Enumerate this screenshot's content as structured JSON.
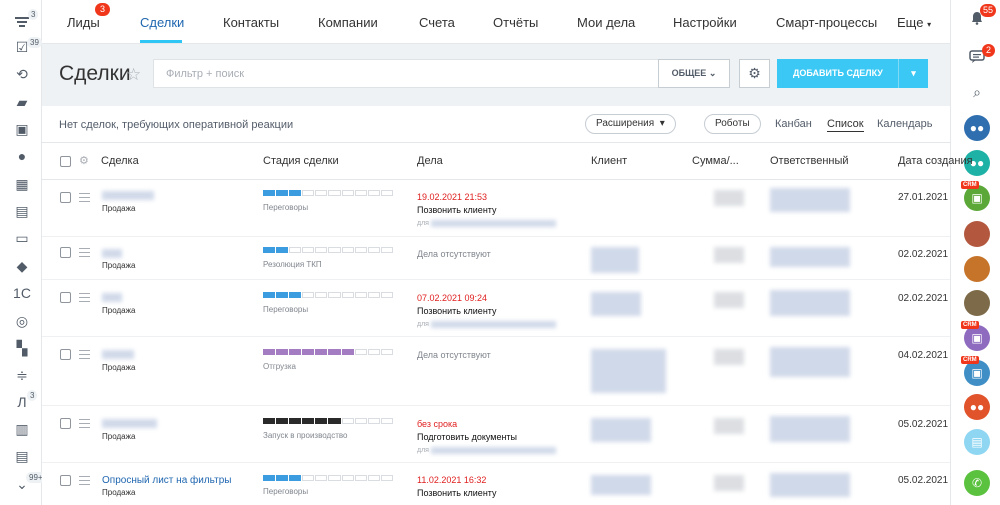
{
  "left_rail": {
    "badges": [
      "3",
      "39",
      "3",
      "99+"
    ],
    "icons": [
      "menu-icon",
      "tasks-icon",
      "sync-icon",
      "chat-icon",
      "contact-card-icon",
      "group-icon",
      "calendar-icon",
      "document-icon",
      "drive-icon",
      "box-icon",
      "crm-icon",
      "target-icon",
      "apps-icon",
      "sliders-icon",
      "l-letter-icon",
      "book-icon",
      "file-icon",
      "more-icon"
    ]
  },
  "topnav": {
    "items": [
      "Лиды",
      "Сделки",
      "Контакты",
      "Компании",
      "Счета",
      "Отчёты",
      "Мои дела",
      "Настройки",
      "Смарт-процессы",
      "Еще"
    ],
    "leads_badge": "3",
    "more_arrow": "▾"
  },
  "right_rail": {
    "bell_badge": "55",
    "chat_badge": "2",
    "crm_tag": "CRM"
  },
  "toolbar": {
    "title": "Сделки",
    "search_placeholder": "Фильтр + поиск",
    "general_label": "ОБЩЕЕ",
    "add_label": "ДОБАВИТЬ СДЕЛКУ"
  },
  "subbar": {
    "text": "Нет сделок, требующих оперативной реакции",
    "extensions_label": "Расширения",
    "robots_label": "Роботы",
    "views": [
      "Канбан",
      "Список",
      "Календарь"
    ]
  },
  "columns": [
    "Сделка",
    "Стадия сделки",
    "Дела",
    "Клиент",
    "Сумма/...",
    "Ответственный",
    "Дата создания"
  ],
  "colors": {
    "accent": "#3bc8f5",
    "link": "#2067b0",
    "stage_blue": "#3b9de0",
    "stage_purple": "#a47cc1",
    "stage_black": "#2a2a2a",
    "overdue": "#e02020"
  },
  "rows": [
    {
      "name": "",
      "type": "Продажа",
      "stage": "Переговоры",
      "stage_fill": 0.3,
      "stage_color": "#3b9de0",
      "act_date": "19.02.2021 21:53",
      "act_text": "Позвонить клиенту",
      "act_for": "для",
      "act_none": "",
      "date": "27.01.2021"
    },
    {
      "name": "",
      "type": "Продажа",
      "stage": "Резолюция ТКП",
      "stage_fill": 0.2,
      "stage_color": "#3b9de0",
      "act_date": "",
      "act_text": "",
      "act_for": "",
      "act_none": "Дела отсутствуют",
      "date": "02.02.2021"
    },
    {
      "name": "",
      "type": "Продажа",
      "stage": "Переговоры",
      "stage_fill": 0.3,
      "stage_color": "#3b9de0",
      "act_date": "07.02.2021 09:24",
      "act_text": "Позвонить клиенту",
      "act_for": "для",
      "act_none": "",
      "date": "02.02.2021"
    },
    {
      "name": "",
      "type": "Продажа",
      "stage": "Отгрузка",
      "stage_fill": 0.7,
      "stage_color": "#a47cc1",
      "act_date": "",
      "act_text": "",
      "act_for": "",
      "act_none": "Дела отсутствуют",
      "date": "04.02.2021"
    },
    {
      "name": "",
      "type": "Продажа",
      "stage": "Запуск в производство",
      "stage_fill": 0.6,
      "stage_color": "#2a2a2a",
      "act_date": "без срока",
      "act_text": "Подготовить документы",
      "act_for": "для",
      "act_none": "",
      "date": "05.02.2021"
    },
    {
      "name": "Опросный лист на фильтры",
      "type": "Продажа",
      "stage": "Переговоры",
      "stage_fill": 0.3,
      "stage_color": "#3b9de0",
      "act_date": "11.02.2021 16:32",
      "act_text": "Позвонить клиенту",
      "act_for": "",
      "act_none": "",
      "date": "05.02.2021"
    }
  ]
}
